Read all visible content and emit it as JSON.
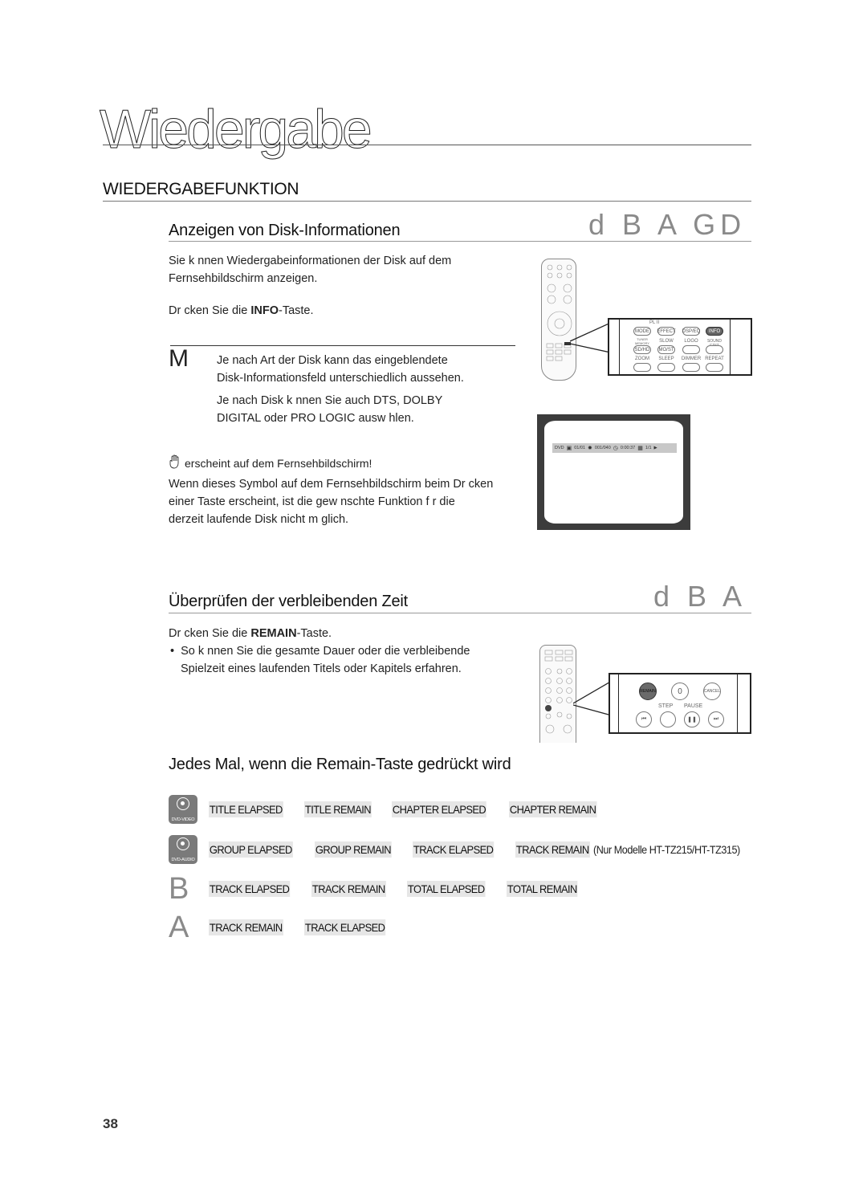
{
  "chapter": {
    "title": "Wiedergabe"
  },
  "section": {
    "title": "WIEDERGABEFUNKTION"
  },
  "disk_info": {
    "title": "Anzeigen von Disk-Informationen",
    "disc_codes": "d B A GD",
    "intro_line1": "Sie k nnen Wiedergabeinformationen der Disk auf dem",
    "intro_line2": "Fernsehbildschirm anzeigen.",
    "press_prefix": "Dr cken Sie die ",
    "press_key": "INFO",
    "press_suffix": "-Taste.",
    "note_mark": "M",
    "note1_line1": "Je nach Art der Disk kann das eingeblendete",
    "note1_line2": "Disk-Informationsfeld unterschiedlich aussehen.",
    "note2_line1": "Je nach Disk k nnen Sie auch DTS, DOLBY",
    "note2_line2": "DIGITAL oder PRO LOGIC ausw hlen.",
    "symbol_heading": "erscheint auf dem Fernsehbildschirm!",
    "symbol_line1": "Wenn dieses Symbol auf dem Fernsehbildschirm beim Dr cken",
    "symbol_line2": "einer Taste erscheint, ist die gew nschte Funktion f r die",
    "symbol_line3": "derzeit laufende Disk nicht m glich.",
    "remote_panel": {
      "pl2_label": "PL II",
      "row1": [
        "MODE",
        "EFFECT",
        "DSP/EQ",
        "INFO"
      ],
      "row2_labels": [
        "TUNER MEMORY",
        "SLOW",
        "LOGO",
        "SOUND EDIT"
      ],
      "row2": [
        "SD/HD",
        "MO/ST",
        "",
        ""
      ],
      "row3_labels": [
        "ZOOM",
        "SLEEP",
        "DIMMER",
        "REPEAT"
      ],
      "highlighted": "INFO"
    },
    "osd": {
      "disc": "DVD",
      "title": "01/01",
      "chapter": "001/040",
      "time": "0:00:37",
      "angle": "1/1"
    }
  },
  "remaining_time": {
    "title": "Überprüfen der verbleibenden Zeit",
    "disc_codes": "d B A",
    "press_prefix": "Dr cken Sie die ",
    "press_key": "REMAIN",
    "press_suffix": "-Taste.",
    "bullet_line1": "So k nnen Sie die gesamte Dauer oder die verbleibende",
    "bullet_line2": "Spielzeit eines laufenden Titels oder Kapitels erfahren.",
    "remote_panel": {
      "row1": [
        "REMAIN",
        "0",
        "CANCEL"
      ],
      "row2_labels": [
        "STEP",
        "PAUSE"
      ],
      "highlighted": "REMAIN"
    }
  },
  "sequence": {
    "title": "Jedes Mal, wenn die Remain-Taste gedrückt wird",
    "rows": [
      {
        "badge": "DVD-VIDEO",
        "items": [
          "TITLE ELAPSED",
          "TITLE REMAIN",
          "CHAPTER ELAPSED",
          "CHAPTER REMAIN"
        ]
      },
      {
        "badge": "DVD-AUDIO",
        "items": [
          "GROUP ELAPSED",
          "GROUP REMAIN",
          "TRACK ELAPSED",
          "TRACK REMAIN"
        ],
        "note": "(Nur Modelle HT-TZ215/HT-TZ315)"
      },
      {
        "letter": "B",
        "items": [
          "TRACK ELAPSED",
          "TRACK REMAIN",
          "TOTAL ELAPSED",
          "TOTAL REMAIN"
        ]
      },
      {
        "letter": "A",
        "items": [
          "TRACK REMAIN",
          "TRACK ELAPSED"
        ]
      }
    ]
  },
  "page_number": "38"
}
